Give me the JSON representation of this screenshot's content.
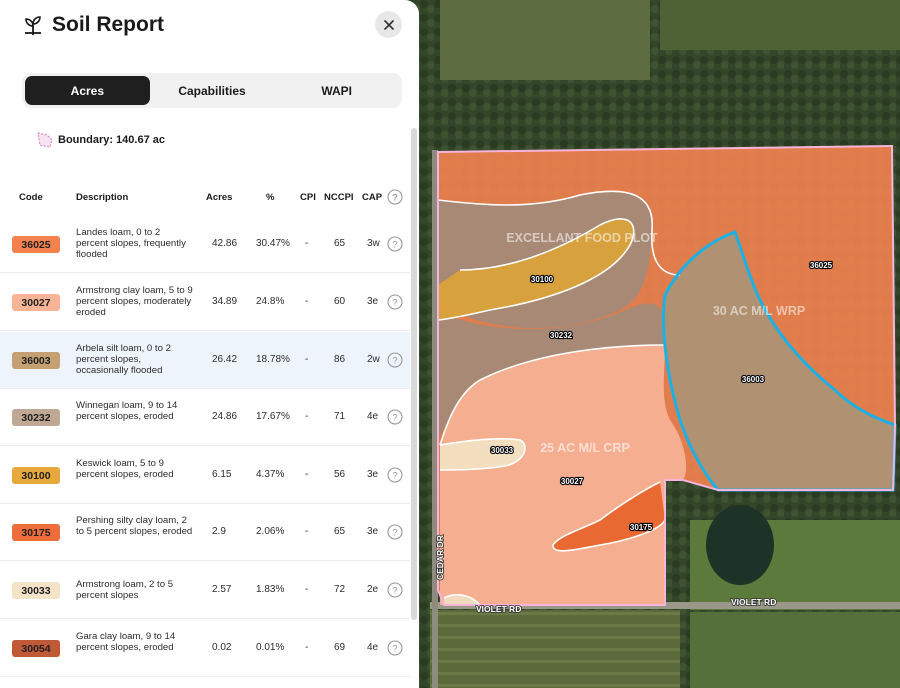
{
  "header": {
    "title": "Soil Report"
  },
  "tabs": [
    {
      "label": "Acres",
      "active": true
    },
    {
      "label": "Capabilities",
      "active": false
    },
    {
      "label": "WAPI",
      "active": false
    }
  ],
  "boundary": {
    "text": "Boundary: 140.67 ac"
  },
  "table": {
    "columns": [
      "Code",
      "Description",
      "Acres",
      "%",
      "CPI",
      "NCCPI",
      "CAP"
    ],
    "rows": [
      {
        "code": "36025",
        "color": "#f4824f",
        "description": "Landes loam, 0 to 2 percent slopes, frequently flooded",
        "acres": "42.86",
        "percent": "30.47%",
        "cpi": "-",
        "nccpi": "65",
        "cap": "3w",
        "highlighted": false
      },
      {
        "code": "30027",
        "color": "#f7b496",
        "description": "Armstrong clay loam, 5 to 9 percent slopes, moderately eroded",
        "acres": "34.89",
        "percent": "24.8%",
        "cpi": "-",
        "nccpi": "60",
        "cap": "3e",
        "highlighted": false
      },
      {
        "code": "36003",
        "color": "#c4a072",
        "description": "Arbela silt loam, 0 to 2 percent slopes, occasionally flooded",
        "acres": "26.42",
        "percent": "18.78%",
        "cpi": "-",
        "nccpi": "86",
        "cap": "2w",
        "highlighted": true
      },
      {
        "code": "30232",
        "color": "#bfa994",
        "description": "Winnegan loam, 9 to 14 percent slopes, eroded",
        "acres": "24.86",
        "percent": "17.67%",
        "cpi": "-",
        "nccpi": "71",
        "cap": "4e",
        "highlighted": false
      },
      {
        "code": "30100",
        "color": "#e7a93d",
        "description": "Keswick loam, 5 to 9 percent slopes, eroded",
        "acres": "6.15",
        "percent": "4.37%",
        "cpi": "-",
        "nccpi": "56",
        "cap": "3e",
        "highlighted": false
      },
      {
        "code": "30175",
        "color": "#ee6d3a",
        "description": "Pershing silty clay loam, 2 to 5 percent slopes, eroded",
        "acres": "2.9",
        "percent": "2.06%",
        "cpi": "-",
        "nccpi": "65",
        "cap": "3e",
        "highlighted": false
      },
      {
        "code": "30033",
        "color": "#f5e3c7",
        "description": "Armstrong loam, 2 to 5 percent slopes",
        "acres": "2.57",
        "percent": "1.83%",
        "cpi": "-",
        "nccpi": "72",
        "cap": "2e",
        "highlighted": false
      },
      {
        "code": "30054",
        "color": "#c05a36",
        "description": "Gara clay loam, 9 to 14 percent slopes, eroded",
        "acres": "0.02",
        "percent": "0.01%",
        "cpi": "-",
        "nccpi": "69",
        "cap": "4e",
        "highlighted": false
      }
    ]
  },
  "map": {
    "zone_labels": [
      "EXCELLANT FOOD PLOT",
      "30 AC M/L WRP",
      "25 AC M/L CRP"
    ],
    "soil_labels": [
      "30100",
      "30232",
      "36025",
      "36003",
      "30033",
      "30027",
      "30175"
    ],
    "road_labels": [
      "VIOLET RD",
      "VIOLET RD",
      "CEDAR DR"
    ],
    "colors": {
      "wrp_outline": "#1bb1e6",
      "boundary": "#f3a8d6"
    }
  }
}
